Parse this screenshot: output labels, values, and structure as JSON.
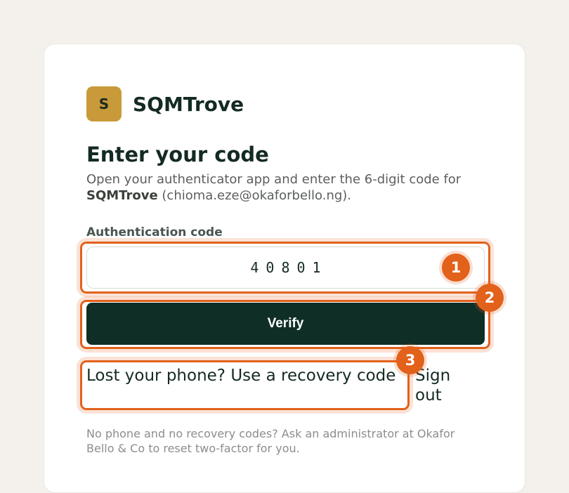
{
  "brand": {
    "logo_letter": "S",
    "name": "SQMTrove",
    "color": "#c89a3a"
  },
  "heading": {
    "title": "Enter your code",
    "description_prefix": "Open your authenticator app and enter the 6-digit code for ",
    "description_app": "SQMTrove",
    "description_suffix": " (chioma.eze@okaforbello.ng)."
  },
  "form": {
    "code_label": "Authentication code",
    "code_value": "40801",
    "verify_label": "Verify",
    "verify_color": "#0f2e26"
  },
  "links": {
    "recovery": "Lost your phone? Use a recovery code",
    "sign_out": "Sign out"
  },
  "help_text": "No phone and no recovery codes? Ask an administrator at Okafor Bello & Co to reset two-factor for you.",
  "annotations": {
    "color": "#e2611b",
    "badges": [
      "1",
      "2",
      "3"
    ]
  }
}
